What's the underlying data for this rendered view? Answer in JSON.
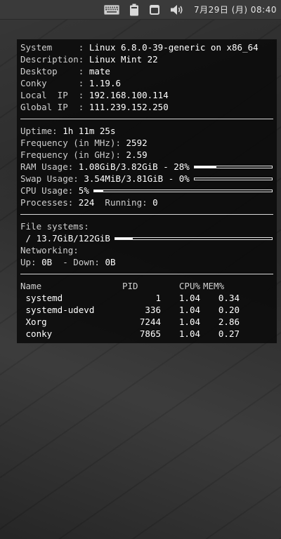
{
  "panel": {
    "clock": "7月29日 (月) 08:40",
    "icons": [
      "keyboard-icon",
      "battery-icon",
      "window-icon",
      "volume-icon"
    ]
  },
  "conky": {
    "system": [
      {
        "label": "System     : ",
        "value": "Linux 6.8.0-39-generic on x86_64"
      },
      {
        "label": "Description: ",
        "value": "Linux Mint 22"
      },
      {
        "label": "Desktop    : ",
        "value": "mate"
      },
      {
        "label": "Conky      : ",
        "value": "1.19.6"
      },
      {
        "label": "Local  IP  : ",
        "value": "192.168.100.114"
      },
      {
        "label": "Global IP  : ",
        "value": "111.239.152.250"
      }
    ],
    "uptime_label": "Uptime: ",
    "uptime_value": "1h 11m 25s",
    "freq_mhz_label": "Frequency (in MHz): ",
    "freq_mhz_value": "2592",
    "freq_ghz_label": "Frequency (in GHz): ",
    "freq_ghz_value": "2.59",
    "ram_label": "RAM Usage: ",
    "ram_value": "1.08GiB/3.82GiB - 28%",
    "ram_fraction": 0.28,
    "swap_label": "Swap Usage: ",
    "swap_value": "3.54MiB/3.81GiB - 0%",
    "swap_fraction": 0.0,
    "cpu_label": "CPU Usage: ",
    "cpu_value": "5%",
    "cpu_fraction": 0.05,
    "processes_label": "Processes: ",
    "processes_value": "224",
    "running_label": "  Running: ",
    "running_value": "0",
    "fs_label": "File systems:",
    "fs_value": " / 13.7GiB/122GiB",
    "fs_fraction": 0.112,
    "net_label": "Networking:",
    "up_label": "Up: ",
    "up_value": "0B",
    "down_label": "  - Down: ",
    "down_value": "0B",
    "proc_headers": [
      "Name",
      "PID",
      "CPU%",
      "MEM%"
    ],
    "procs": [
      {
        "name": " systemd",
        "pid": "1",
        "cpu": "1.04",
        "mem": "0.34"
      },
      {
        "name": " systemd-udevd",
        "pid": "336",
        "cpu": "1.04",
        "mem": "0.20"
      },
      {
        "name": " Xorg",
        "pid": "7244",
        "cpu": "1.04",
        "mem": "2.86"
      },
      {
        "name": " conky",
        "pid": "7865",
        "cpu": "1.04",
        "mem": "0.27"
      }
    ]
  }
}
